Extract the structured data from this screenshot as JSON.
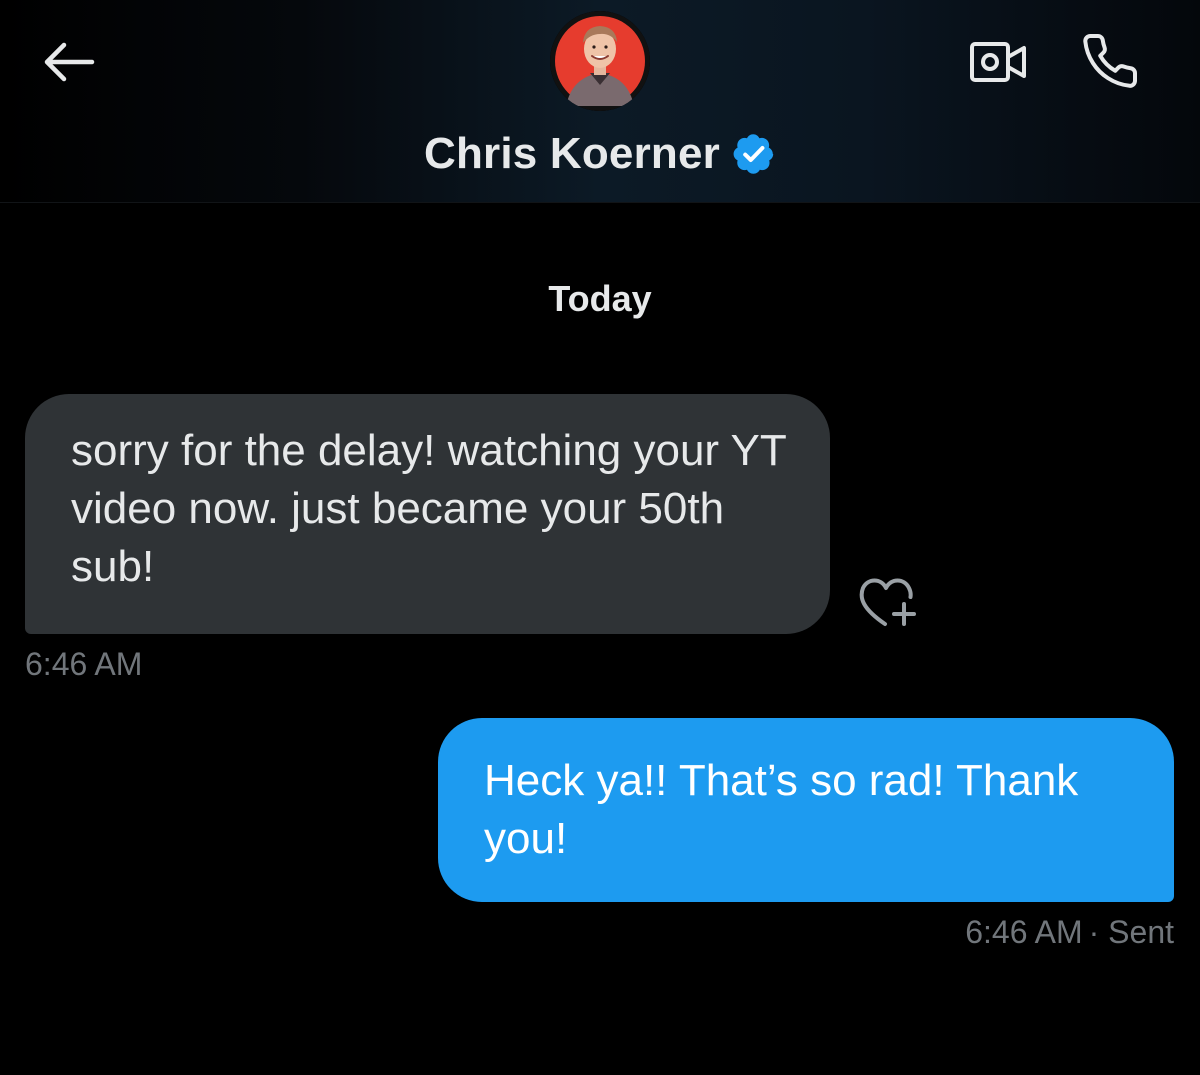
{
  "header": {
    "contact_name": "Chris Koerner",
    "back_icon": "arrow-left-icon",
    "video_icon": "video-camera-icon",
    "call_icon": "phone-icon",
    "verified_icon": "verified-badge-icon",
    "accent_color": "#1d9bf0"
  },
  "conversation": {
    "day_label": "Today",
    "messages": [
      {
        "direction": "incoming",
        "text": "sorry for the delay! watching your YT video now. just became your 50th sub!",
        "time": "6:46 AM",
        "react_icon": "heart-plus-icon",
        "bubble_color": "#2f3336"
      },
      {
        "direction": "outgoing",
        "text": "Heck ya!! That’s so rad! Thank you!",
        "time": "6:46 AM",
        "status": "· Sent",
        "bubble_color": "#1d9bf0"
      }
    ]
  }
}
